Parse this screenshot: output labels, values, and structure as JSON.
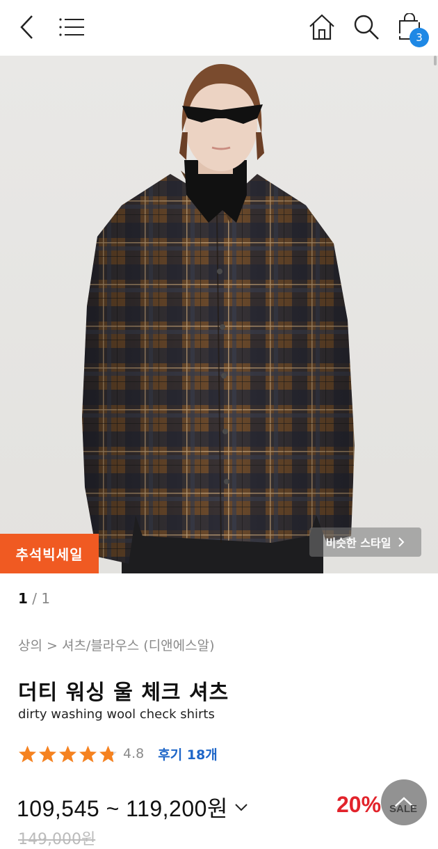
{
  "header": {
    "back_icon": "chevron-left-icon",
    "menu_icon": "hamburger-menu-icon",
    "home_icon": "home-icon",
    "search_icon": "search-icon",
    "cart_icon": "shopping-bag-icon",
    "cart_count": "3"
  },
  "gallery": {
    "promo_label": "추석빅세일",
    "similar_style_label": "비슷한 스타일",
    "page_current": "1",
    "page_sep": "/ ",
    "page_total": "1"
  },
  "product": {
    "breadcrumb": "상의 > 셔츠/블라우스 (디앤에스알)",
    "title_ko": "더티 워싱 울 체크 셔츠",
    "title_en": "dirty washing wool check shirts",
    "rating": 4.8,
    "rating_text": "4.8",
    "review_label": "후기 18개",
    "price_range": "109,545 ~ 119,200원",
    "discount": "20%",
    "sale_label": "SALE",
    "original_price": "149,000원"
  },
  "colors": {
    "accent_blue": "#1e88e5",
    "promo_orange": "#f05a22",
    "discount_red": "#e2232b",
    "star_orange": "#f58220"
  }
}
